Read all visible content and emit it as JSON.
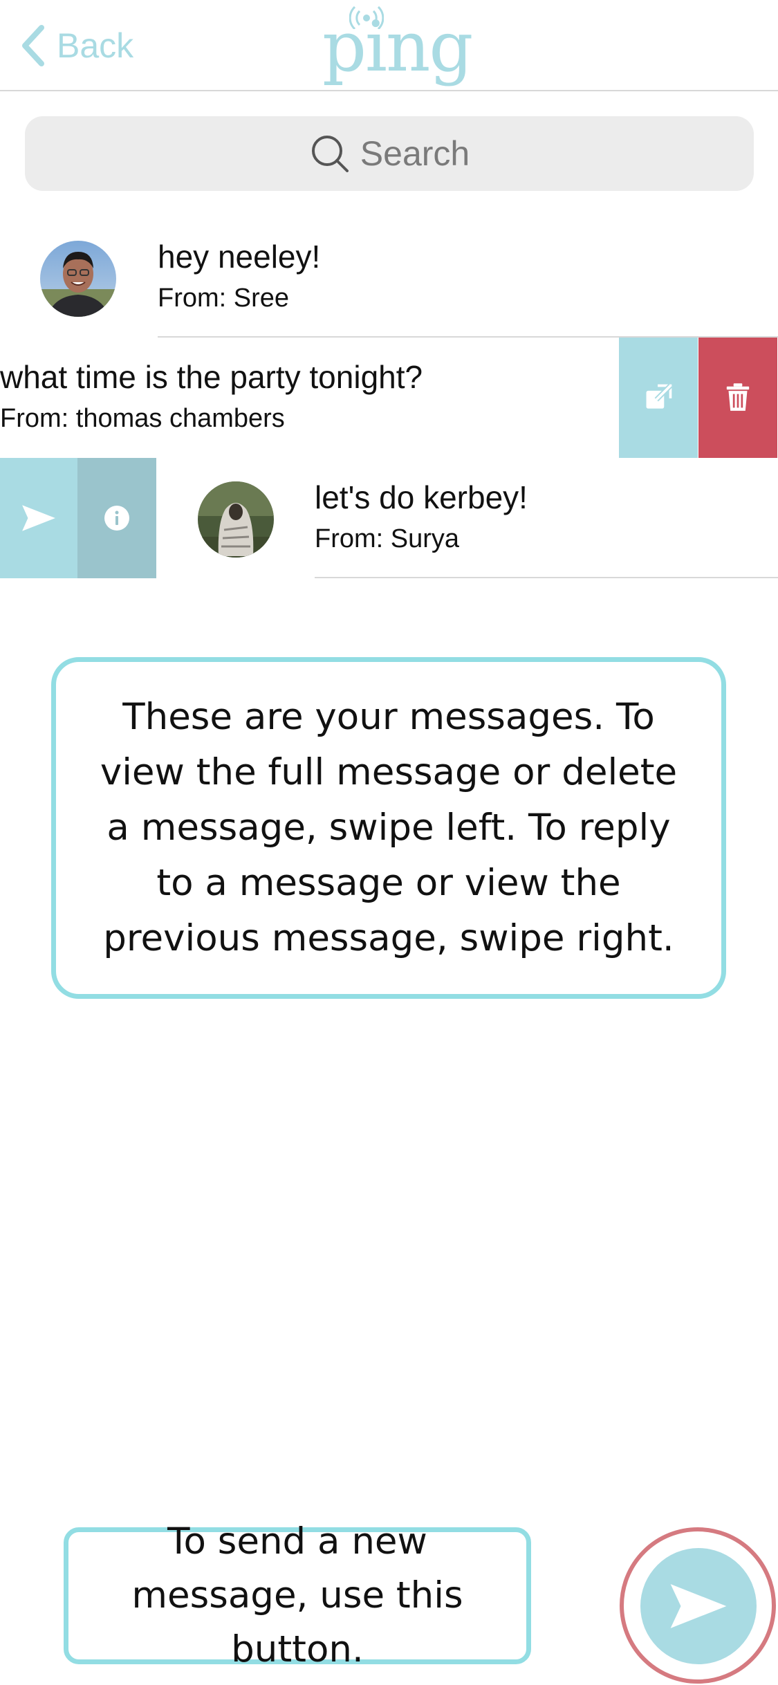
{
  "header": {
    "back_label": "Back",
    "logo_text": "ping"
  },
  "search": {
    "placeholder": "Search"
  },
  "messages": [
    {
      "title": "hey neeley!",
      "from": "From: Sree",
      "swipe_state": "none"
    },
    {
      "title": "what time is the party tonight?",
      "from": "From: thomas chambers",
      "swipe_state": "swiped-left",
      "actions": [
        "open-full-message",
        "delete"
      ]
    },
    {
      "title": "let's do kerbey!",
      "from": "From: Surya",
      "swipe_state": "swiped-right",
      "actions": [
        "reply",
        "info"
      ]
    }
  ],
  "tutorial": {
    "messages_hint": "These are your messages. To view the full message or delete a message, swipe left. To reply to a message or view the previous message, swipe right.",
    "compose_hint": "To send a new message, use this button."
  },
  "colors": {
    "accent": "#a9dbe3",
    "action_dark": "#9ac4cc",
    "delete": "#cc4e5c",
    "callout_border": "#92dde3",
    "compose_ring": "#d57a80"
  },
  "icons": [
    "chevron-left-icon",
    "search-icon",
    "external-link-icon",
    "trash-icon",
    "send-icon",
    "info-icon"
  ]
}
